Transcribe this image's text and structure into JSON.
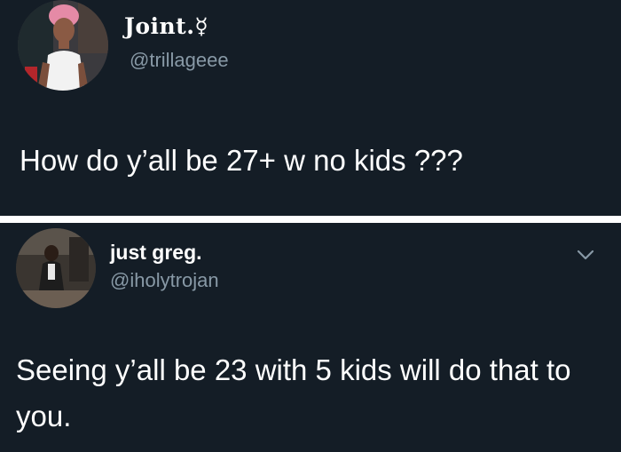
{
  "tweets": [
    {
      "display_name": "Joint.☿",
      "handle": "@trillageee",
      "text": "How do y’all be 27+ w no kids ???"
    },
    {
      "display_name": "just greg.",
      "handle": "@iholytrojan",
      "text": "Seeing y’all be 23 with 5 kids will do that to you."
    }
  ],
  "colors": {
    "background": "#141d26",
    "text": "#ffffff",
    "handle": "#8899a6",
    "divider": "#ffffff"
  }
}
